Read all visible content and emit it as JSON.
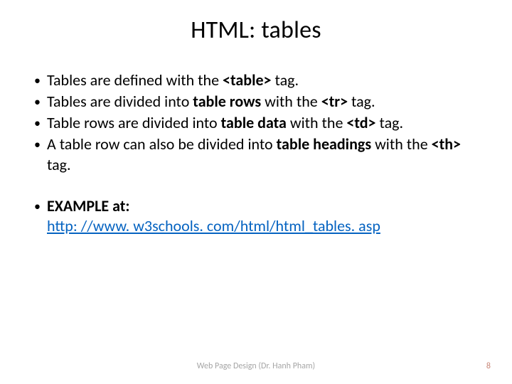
{
  "title": "HTML: tables",
  "bullets_a": [
    {
      "pre": "Tables are defined with the ",
      "b1": "<table>",
      "post": " tag."
    },
    {
      "pre": "Tables are divided into ",
      "b1": "table rows",
      "mid": " with the ",
      "b2": "<tr>",
      "post": " tag."
    },
    {
      "pre": "Table rows are divided into ",
      "b1": "table data",
      "mid": " with the ",
      "b2": "<td>",
      "post": " tag."
    },
    {
      "pre": "A table row can also be divided into ",
      "b1": "table headings",
      "mid": " with the ",
      "b2": "<th>",
      "post": " tag."
    }
  ],
  "example_label": "EXAMPLE at:",
  "example_link": "http: //www. w3schools. com/html/html_tables. asp",
  "footer": "Web Page Design (Dr. Hanh Pham)",
  "page": "8"
}
